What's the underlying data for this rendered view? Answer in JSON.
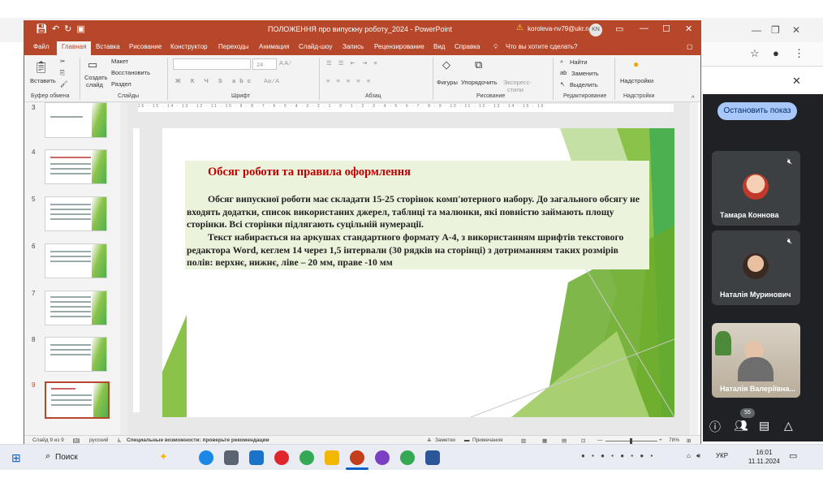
{
  "window": {
    "title": "ПОЛОЖЕННЯ про випускну роботу_2024 - PowerPoint",
    "account": "koroleva-nv79@ukr.net",
    "avatar_initials": "KN"
  },
  "tabs": [
    "Файл",
    "Главная",
    "Вставка",
    "Рисование",
    "Конструктор",
    "Переходы",
    "Анимация",
    "Слайд-шоу",
    "Запись",
    "Рецензирование",
    "Вид",
    "Справка"
  ],
  "tell_me": "Что вы хотите сделать?",
  "ribbon": {
    "paste": "Вставить",
    "new_slide": "Создать",
    "new_slide_2": "слайд",
    "layout": "Макет",
    "reset": "Восстановить",
    "section": "Раздел",
    "font_size": "24",
    "shapes": "Фигуры",
    "arrange": "Упорядочить",
    "quick_styles": "Экспресс-",
    "quick_styles_2": "стили",
    "find": "Найти",
    "replace": "Заменить",
    "select": "Выделить",
    "addins": "Надстройки",
    "groups": [
      "Буфер обмена",
      "Слайды",
      "Шрифт",
      "Абзац",
      "Рисование",
      "Редактирование",
      "Надстройки"
    ]
  },
  "thumbnails": [
    {
      "num": "3"
    },
    {
      "num": "4"
    },
    {
      "num": "5"
    },
    {
      "num": "6"
    },
    {
      "num": "7"
    },
    {
      "num": "8"
    },
    {
      "num": "9"
    }
  ],
  "ruler_text": "16 · 15 · 14 · 13 · 12 · 11 · 10 · 9 · 8 · 7 · 6 · 5 · 4 · 3 · 2 · 1 · 0 · 1 · 2 · 3 · 4 · 5 · 6 · 7 · 8 · 9 · 10 · 11 · 12 · 13 · 14 · 15 · 16",
  "slide": {
    "title": "Обсяг роботи та правила оформлення",
    "paragraph1": "Обсяг випускної роботи має складати 15-25 сторінок комп'ютерного набору. До загального обсягу не входять додатки, список використаних джерел, таблиці та малюнки, які повністю займають площу сторінки. Всі сторінки підлягають суцільній нумерації.",
    "paragraph2": "Текст набирається на аркушах стандартного формату А-4, з використанням шрифтів текстового редактора Word, кеглем 14 через 1,5 інтервали (30 рядків на сторінці) з дотриманням таких розмірів полів: верхнє, нижнє, ліве – 20 мм, праве -10 мм"
  },
  "status": {
    "slide_of": "Слайд 9 из 9",
    "language": "русский",
    "accessibility": "Специальные возможности: проверьте рекомендации",
    "notes": "Заметки",
    "comments": "Примечания",
    "zoom": "78%"
  },
  "meet": {
    "stop_button": "Остановить показ",
    "participants": [
      "Тамара Коннова",
      "Наталія Муринович",
      "Наталія Валеріївна..."
    ],
    "people_count": "55"
  },
  "taskbar": {
    "search": "Поиск",
    "lang": "УКР",
    "time": "16:01",
    "date": "11.11.2024"
  },
  "colors": {
    "ppt_accent": "#b7472a",
    "slide_title": "#c00000",
    "textbox_bg": "#ebf3dc",
    "meet_bg": "#202124"
  }
}
